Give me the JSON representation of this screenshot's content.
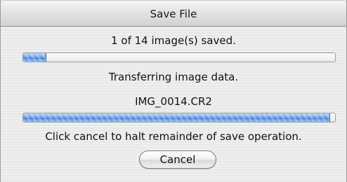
{
  "window": {
    "title": "Save File"
  },
  "status": {
    "saved_count_text": "1 of 14 image(s) saved.",
    "overall_progress": 0.075,
    "activity_text": "Transferring image data.",
    "current_file": "IMG_0014.CR2",
    "file_progress": 0.985,
    "instruction_text": "Click cancel to halt remainder of save operation."
  },
  "buttons": {
    "cancel_label": "Cancel"
  },
  "colors": {
    "progress_accent": "#3f85de",
    "window_background": "#ececec"
  }
}
